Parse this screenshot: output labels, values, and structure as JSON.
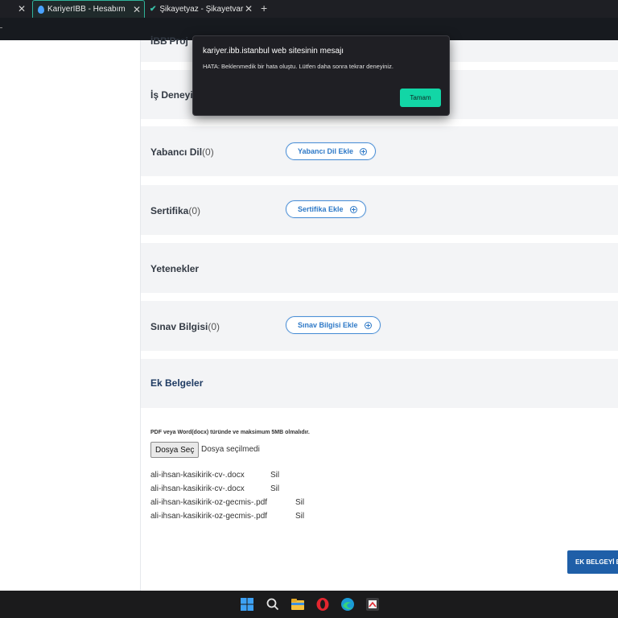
{
  "browser": {
    "tabs": [
      {
        "title": "KariyerIBB - Hesabım",
        "close_glyph": "✕"
      },
      {
        "title": "Şikayetyaz - Şikayetvar",
        "close_glyph": "✕"
      }
    ],
    "prev_tab_close_glyph": "✕",
    "new_tab_glyph": "+"
  },
  "partial_sections": {
    "top_label": "İBB'Proj",
    "is_deneyimi_label": "İş Deneyim"
  },
  "sections": [
    {
      "title": "Yabancı Dil",
      "count": "(0)",
      "button": "Yabancı Dil Ekle"
    },
    {
      "title": "Sertifika",
      "count": "(0)",
      "button": "Sertifika Ekle"
    },
    {
      "title": "Yetenekler"
    },
    {
      "title": "Sınav Bilgisi",
      "count": "(0)",
      "button": "Sınav Bilgisi Ekle"
    }
  ],
  "ek_belgeler": {
    "title": "Ek Belgeler",
    "hint": "PDF veya Word(docx) türünde ve maksimum 5MB olmalıdır.",
    "choose_file_label": "Dosya Seç",
    "file_status": "Dosya seçilmedi",
    "files": [
      {
        "name": "ali-ihsan-kasikirik-cv-.docx",
        "delete": "Sil"
      },
      {
        "name": "ali-ihsan-kasikirik-cv-.docx",
        "delete": "Sil"
      },
      {
        "name": "ali-ihsan-kasikirik-oz-gecmis-.pdf",
        "delete": "Sil"
      },
      {
        "name": "ali-ihsan-kasikirik-oz-gecmis-.pdf",
        "delete": "Sil"
      }
    ],
    "submit_label": "EK BELGEYİ EKLE"
  },
  "dialog": {
    "title": "kariyer.ibb.istanbul web sitesinin mesajı",
    "message": "HATA: Beklenmedik bir hata oluştu. Lütfen daha sonra tekrar deneyiniz.",
    "ok_label": "Tamam"
  },
  "taskbar": {
    "icons": [
      "windows-start-icon",
      "search-icon",
      "file-explorer-icon",
      "opera-icon",
      "edge-icon",
      "snipping-tool-icon"
    ]
  },
  "colors": {
    "accent_button": "#12d6a6",
    "link_blue": "#2e79c7",
    "submit_blue": "#1f5fa8",
    "section_bg": "#f3f4f6"
  }
}
